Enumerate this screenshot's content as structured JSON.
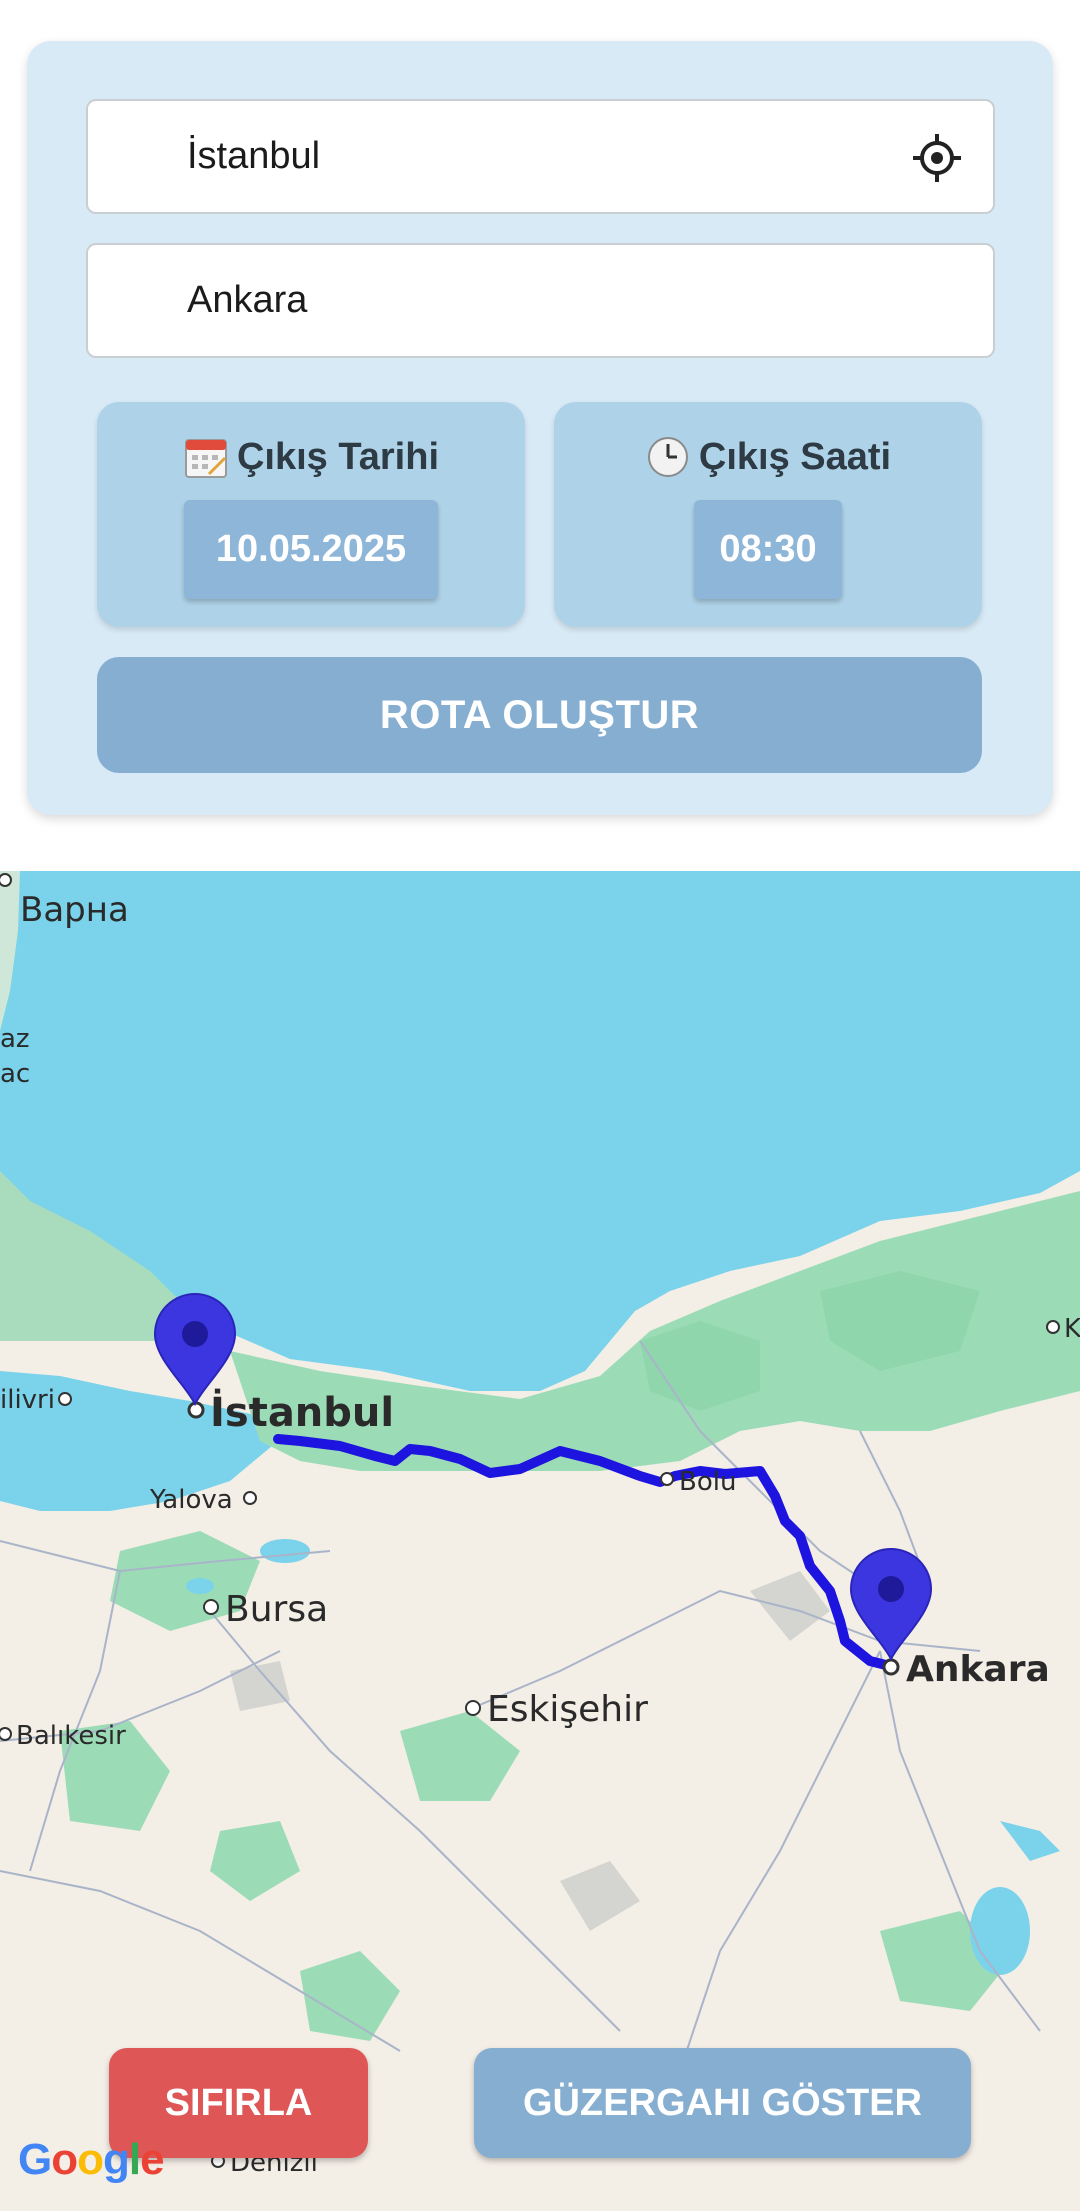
{
  "form": {
    "from_value": "İstanbul",
    "to_value": "Ankara",
    "date_label": "Çıkış Tarihi",
    "date_value": "10.05.2025",
    "time_label": "Çıkış Saati",
    "time_value": "08:30",
    "create_route_label": "ROTA OLUŞTUR",
    "icons": {
      "locate": "crosshair-icon",
      "date": "calendar-icon",
      "time": "clock-icon"
    }
  },
  "map": {
    "labels": {
      "varna": "Варна",
      "az": "az",
      "ac": "ac",
      "silivri": "ilivri",
      "istanbul": "İstanbul",
      "yalova": "Yalova",
      "bursa": "Bursa",
      "bolu": "Bolu",
      "ankara": "Ankara",
      "eskisehir": "Eskişehir",
      "balikesir": "Balıkesir",
      "denizli": "Denizli",
      "k": "K"
    },
    "colors": {
      "sea": "#7ad3ea",
      "land": "#f3eee6",
      "forest": "#9bdcb7",
      "route": "#1d14e0",
      "marker": "#3b36e0"
    }
  },
  "actions": {
    "reset_label": "SIFIRLA",
    "show_route_label": "GÜZERGAHI GÖSTER"
  },
  "attribution": {
    "logo": "Google"
  }
}
